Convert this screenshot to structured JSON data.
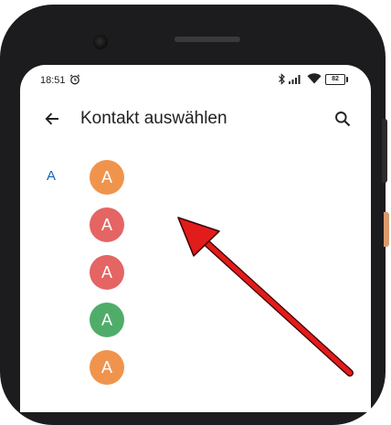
{
  "status_bar": {
    "time": "18:51",
    "battery_level": "82",
    "icons": [
      "alarm-icon",
      "bluetooth-icon",
      "signal-icon",
      "wifi-icon",
      "battery-icon"
    ]
  },
  "app_bar": {
    "title": "Kontakt auswählen",
    "icons": [
      "back-arrow-icon",
      "search-icon"
    ]
  },
  "section": {
    "letter": "A"
  },
  "contacts": [
    {
      "initial": "A",
      "color": "#f0944d"
    },
    {
      "initial": "A",
      "color": "#e46563"
    },
    {
      "initial": "A",
      "color": "#e46563"
    },
    {
      "initial": "A",
      "color": "#4fad69"
    },
    {
      "initial": "A",
      "color": "#f0944d"
    }
  ],
  "annotation": {
    "type": "pointer-arrow",
    "color": "#e21b1b"
  }
}
